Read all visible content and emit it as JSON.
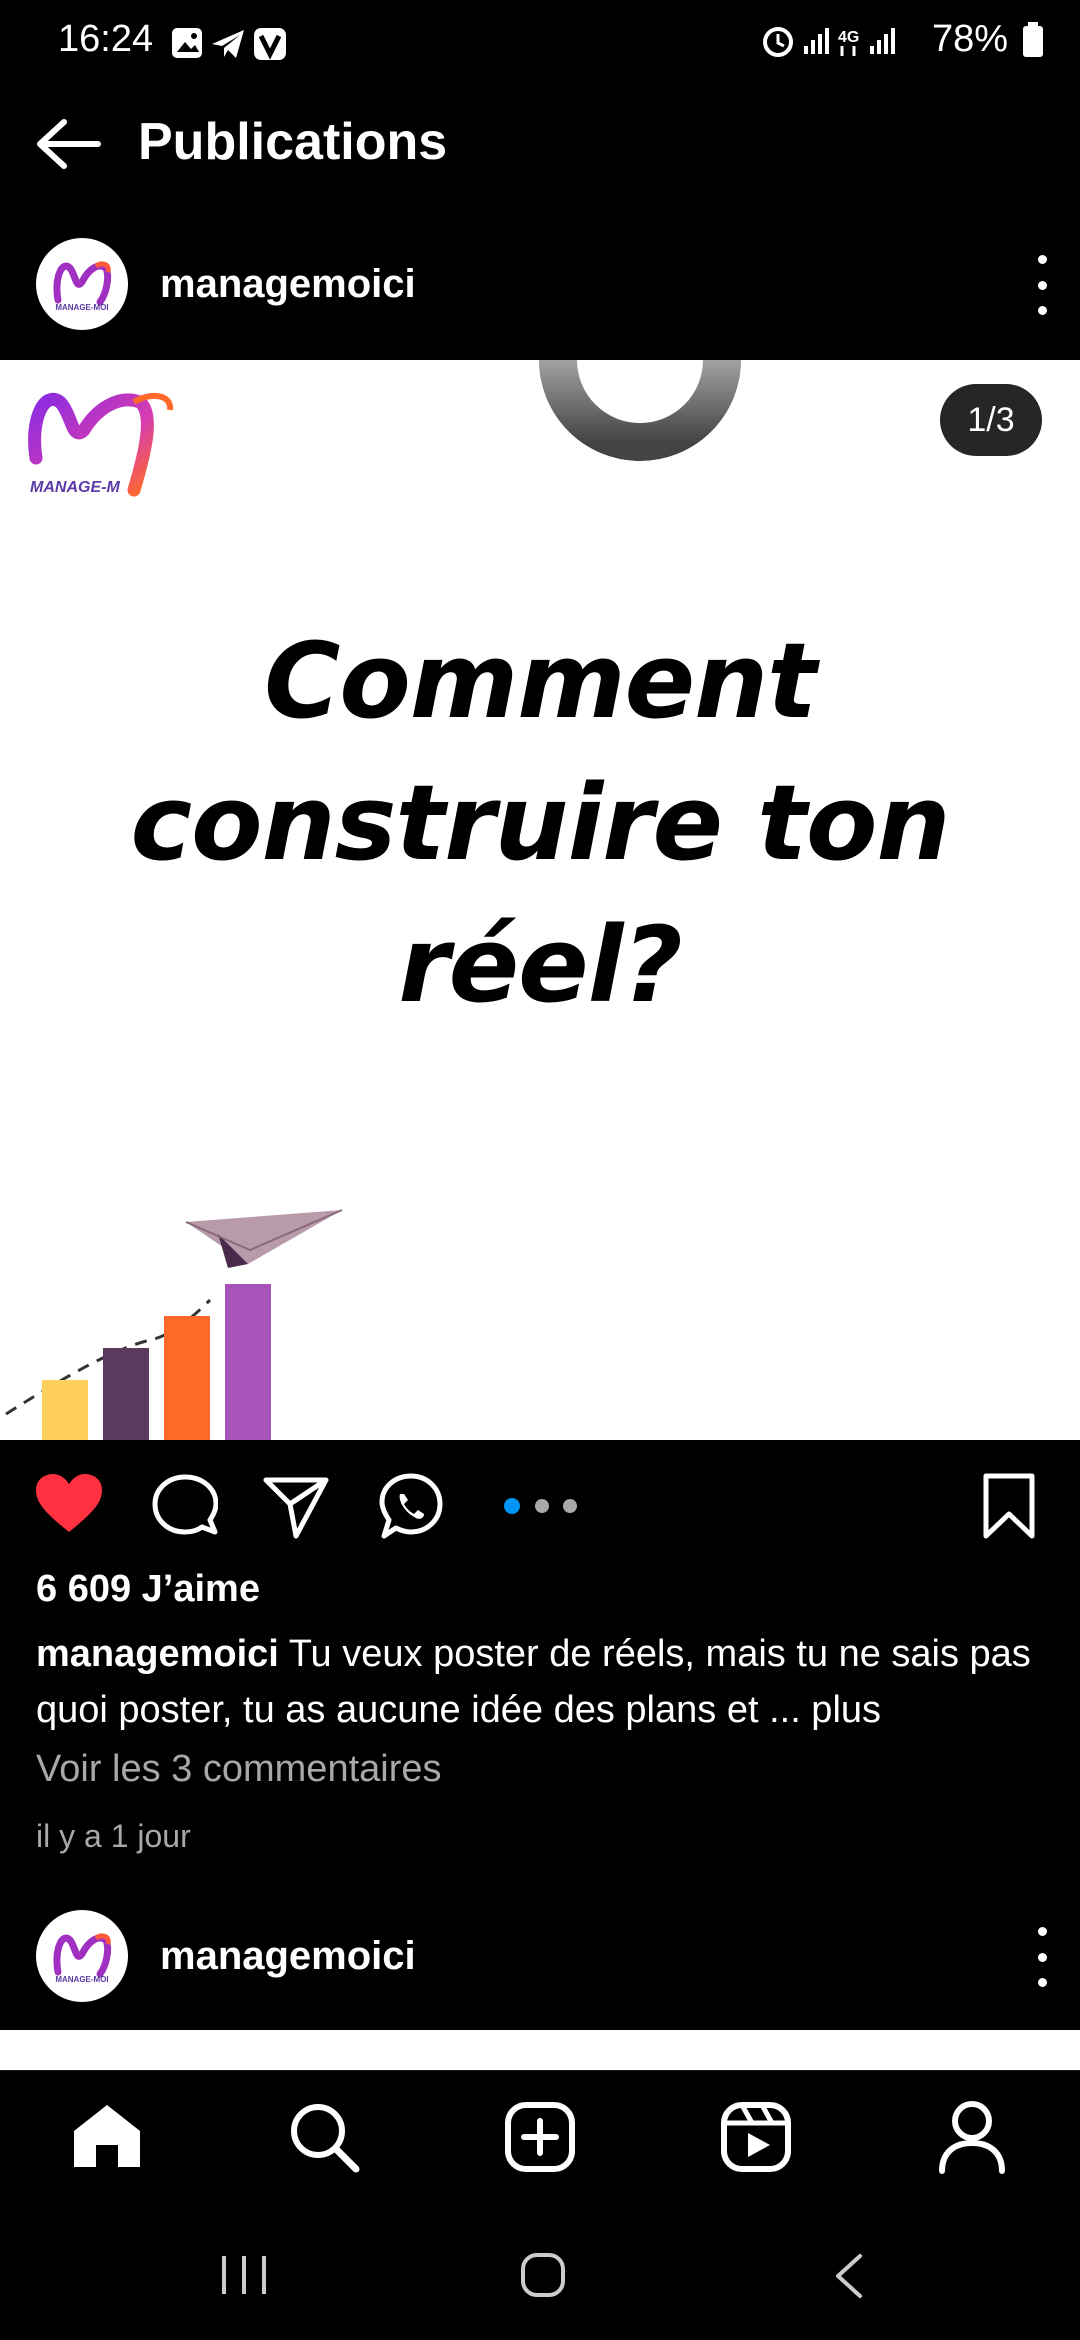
{
  "status_bar": {
    "time": "16:24",
    "battery": "78%",
    "icons": [
      "gallery-icon",
      "telegram-icon",
      "v-app-icon",
      "alarm-icon",
      "signal-icon",
      "4g-icon",
      "signal-icon",
      "battery-icon"
    ]
  },
  "header": {
    "title": "Publications",
    "back_icon": "arrow-left-icon"
  },
  "post": {
    "username": "managemoici",
    "avatar_text": "MANAGE-MOI",
    "logo_text": "MANAGE-M",
    "image_counter": "1/3",
    "headline_lines": [
      "Comment",
      "construire ton",
      "réel?"
    ],
    "likes": "6 609 J’aime",
    "caption_user": "managemoici",
    "caption_text": " Tu veux poster de réels, mais tu ne sais pas quoi poster, tu as aucune idée des plans et ... plus",
    "comments_link": "Voir les 3 commentaires",
    "time_ago": "il y a 1 jour"
  },
  "next_post": {
    "username": "managemoici"
  },
  "colors": {
    "background": "#000000",
    "like_red": "#ff3040",
    "dot_active": "#0095f6",
    "muted": "#a8a8a8",
    "bars": [
      "#ffcf5c",
      "#5b3a5e",
      "#ff6a2b",
      "#a754b8"
    ]
  },
  "bottom_nav": [
    "home-icon",
    "search-icon",
    "create-icon",
    "reels-icon",
    "profile-icon"
  ],
  "system_nav": [
    "recent-apps-icon",
    "home-circle-icon",
    "back-chevron-icon"
  ]
}
